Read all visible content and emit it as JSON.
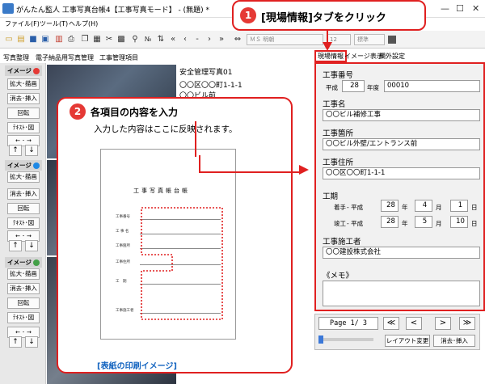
{
  "window": {
    "title": "がんたん監人 工事写真台帳4【工事写真モード】 - (無題) *"
  },
  "menu": [
    "ファイル(F)",
    "ツール(T)",
    "ヘルプ(H)"
  ],
  "toolbar": {
    "font_name": "ＭＳ 明朝",
    "font_size": "12",
    "font_style": "標準"
  },
  "left_tabs": [
    "写真整理",
    "電子納品用写真管理",
    "工事管理項目"
  ],
  "images": [
    {
      "label": "イメージ",
      "color": "#e53935",
      "buttons": [
        "拡大･描画",
        "消去･挿入",
        "回転",
        "ﾃｷｽﾄ･図"
      ]
    },
    {
      "label": "イメージ",
      "color": "#1e88e5",
      "buttons": [
        "拡大･描画",
        "消去･挿入",
        "回転",
        "ﾃｷｽﾄ･図"
      ]
    },
    {
      "label": "イメージ",
      "color": "#43a047",
      "buttons": [
        "拡大･描画",
        "消去･挿入",
        "回転",
        "ﾃｷｽﾄ･図"
      ]
    }
  ],
  "arrows": {
    "lr": "← ･ →",
    "up": "↑",
    "down": "↓"
  },
  "photo_text": {
    "line1": "安全管理写真01",
    "line2": "〇〇区〇〇町1-1-1",
    "line3": "〇〇ビル前"
  },
  "callout1": {
    "num": "1",
    "text": "[現場情報]タブをクリック"
  },
  "right_tabs": [
    "現場情報",
    "イメージ表示",
    "欄外設定"
  ],
  "site": {
    "no_label": "工事番号",
    "era": "平成",
    "year": "28",
    "year_unit": "年度",
    "number": "00010",
    "name_label": "工事名",
    "name": "〇〇ビル補修工事",
    "place_label": "工事箇所",
    "place": "〇〇ビル外壁/エントランス前",
    "addr_label": "工事住所",
    "addr": "〇〇区〇〇町1-1-1",
    "period_label": "工期",
    "start_label": "着手",
    "end_label": "竣工",
    "heisei": "- 平成",
    "start": {
      "y": "28",
      "m": "4",
      "d": "1"
    },
    "end": {
      "y": "28",
      "m": "5",
      "d": "10"
    },
    "unit_y": "年",
    "unit_m": "月",
    "unit_d": "日",
    "contractor_label": "工事施工者",
    "contractor": "〇〇建設株式会社",
    "memo_label": "《メモ》"
  },
  "nav": {
    "page": "Page 1/ 3",
    "first": "≪",
    "prev": "<",
    "next": ">",
    "last": "≫",
    "layout_btn": "レイアウト変更",
    "erase_btn": "消去･挿入"
  },
  "callout2": {
    "num": "2",
    "head": "各項目の内容を入力",
    "sub": "入力した内容はここに反映されます。",
    "doc_title": "工事写真帳台帳",
    "doc_rows": [
      "工事番号",
      "工 事 名",
      "工事箇所",
      "工事住所",
      "工　期",
      "工事施工者"
    ],
    "caption": "[表紙の印刷イメージ]"
  }
}
